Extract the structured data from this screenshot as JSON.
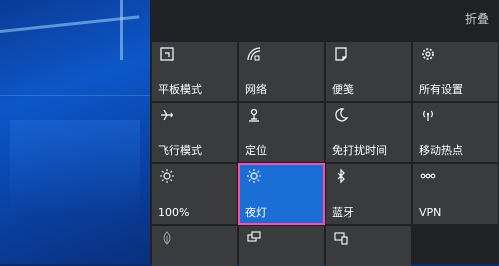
{
  "header": {
    "collapse_label": "折叠"
  },
  "tiles": [
    {
      "label": "平板模式",
      "icon": "tablet-mode-icon",
      "active": false
    },
    {
      "label": "网络",
      "icon": "network-icon",
      "active": false
    },
    {
      "label": "便笺",
      "icon": "note-icon",
      "active": false
    },
    {
      "label": "所有设置",
      "icon": "gear-icon",
      "active": false
    },
    {
      "label": "飞行模式",
      "icon": "airplane-icon",
      "active": false
    },
    {
      "label": "定位",
      "icon": "location-icon",
      "active": false
    },
    {
      "label": "免打扰时间",
      "icon": "moon-icon",
      "active": false
    },
    {
      "label": "移动热点",
      "icon": "hotspot-icon",
      "active": false
    },
    {
      "label": "100%",
      "icon": "brightness-icon",
      "active": false
    },
    {
      "label": "夜灯",
      "icon": "night-light-icon",
      "active": true
    },
    {
      "label": "蓝牙",
      "icon": "bluetooth-icon",
      "active": false
    },
    {
      "label": "VPN",
      "icon": "vpn-icon",
      "active": false
    },
    {
      "label": "",
      "icon": "battery-saver-icon",
      "active": false
    },
    {
      "label": "",
      "icon": "project-icon",
      "active": false
    },
    {
      "label": "",
      "icon": "connect-icon",
      "active": false
    }
  ],
  "colors": {
    "tile": "#3a3b3d",
    "active_tile": "#1b6ed6",
    "highlight": "#ff4fae",
    "panel": "#202124"
  }
}
